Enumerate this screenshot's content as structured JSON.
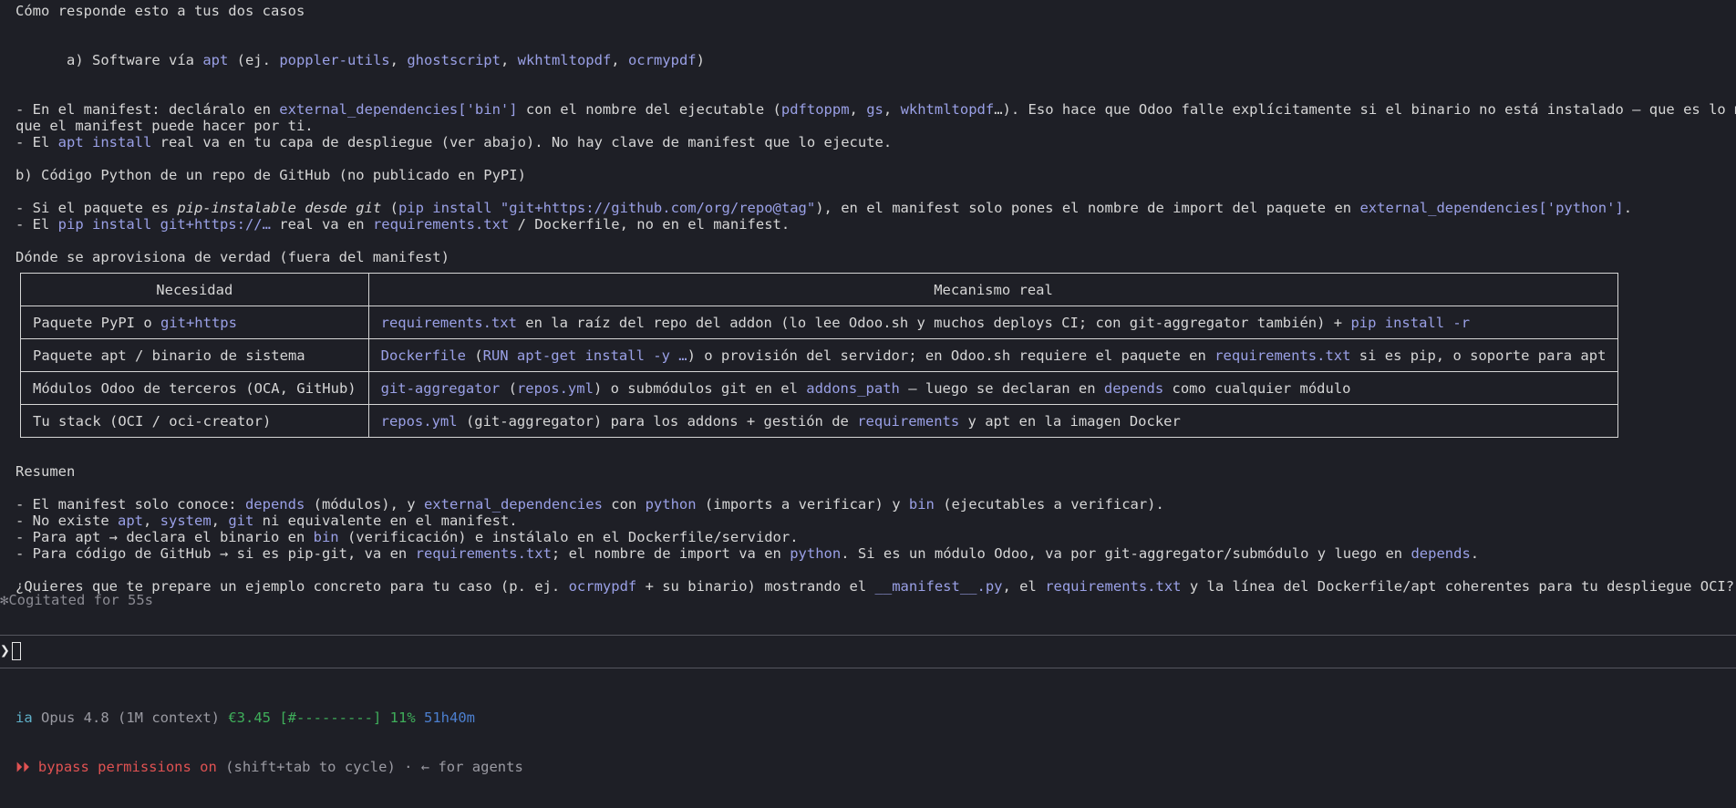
{
  "lines": {
    "h1": "Cómo responde esto a tus dos casos",
    "a": [
      "a) Software vía ",
      "apt",
      " (ej. ",
      "poppler-utils",
      ", ",
      "ghostscript",
      ", ",
      "wkhtmltopdf",
      ", ",
      "ocrmypdf",
      ")"
    ],
    "a1": [
      "- En el manifest: decláralo en ",
      "external_dependencies['bin']",
      " con el nombre del ejecutable (",
      "pdftoppm",
      ", ",
      "gs",
      ", ",
      "wkhtmltopdf",
      "…). Eso hace que Odoo falle explícitamente si el binario no está instalado — que es lo máximo"
    ],
    "a1b": "que el manifest puede hacer por ti.",
    "a2": [
      "- El ",
      "apt install",
      " real va en tu capa de despliegue (ver abajo). No hay clave de manifest que lo ejecute."
    ],
    "b": "b) Código Python de un repo de GitHub (no publicado en PyPI)",
    "b1": [
      "- Si el paquete es ",
      "pip-instalable desde git",
      " (",
      "pip install \"git+https://github.com/org/repo@tag\"",
      "), en el manifest solo pones el nombre de import del paquete en ",
      "external_dependencies['python']",
      "."
    ],
    "b2": [
      "- El ",
      "pip install git+https://…",
      " real va en ",
      "requirements.txt",
      " / Dockerfile, no en el manifest."
    ],
    "h2": "Dónde se aprovisiona de verdad (fuera del manifest)",
    "resumen": "Resumen",
    "r1": [
      "- El manifest solo conoce: ",
      "depends",
      " (módulos), y ",
      "external_dependencies",
      " con ",
      "python",
      " (imports a verificar) y ",
      "bin",
      " (ejecutables a verificar)."
    ],
    "r2": [
      "- No existe ",
      "apt",
      ", ",
      "system",
      ", ",
      "git",
      " ni equivalente en el manifest."
    ],
    "r3": [
      "- Para apt → declara el binario en ",
      "bin",
      " (verificación) e instálalo en el Dockerfile/servidor."
    ],
    "r4": [
      "- Para código de GitHub → si es pip-git, va en ",
      "requirements.txt",
      "; el nombre de import va en ",
      "python",
      ". Si es un módulo Odoo, va por git-aggregator/submódulo y luego en ",
      "depends",
      "."
    ],
    "q": [
      "¿Quieres que te prepare un ejemplo concreto para tu caso (p. ej. ",
      "ocrmypdf",
      " + su binario) mostrando el ",
      "__manifest__.py",
      ", el ",
      "requirements.txt",
      " y la línea del Dockerfile/apt coherentes para tu despliegue OCI?"
    ]
  },
  "table": {
    "headers": [
      "Necesidad",
      "Mecanismo real"
    ],
    "rows": [
      {
        "need": [
          "Paquete PyPI o ",
          "git+https"
        ],
        "mech": [
          "requirements.txt",
          " en la raíz del repo del addon (lo lee Odoo.sh y muchos deploys CI; con git-aggregator también) + ",
          "pip install -r"
        ]
      },
      {
        "need": [
          "Paquete apt / binario de sistema"
        ],
        "mech": [
          "Dockerfile",
          " (",
          "RUN apt-get install -y …",
          ") o provisión del servidor; en Odoo.sh requiere el paquete en ",
          "requirements.txt",
          " si es pip, o soporte para apt"
        ]
      },
      {
        "need": [
          "Módulos Odoo de terceros (OCA, GitHub)"
        ],
        "mech": [
          "git-aggregator",
          " (",
          "repos.yml",
          ") o submódulos git en el ",
          "addons_path",
          " — luego se declaran en ",
          "depends",
          " como cualquier módulo"
        ]
      },
      {
        "need": [
          "Tu stack (OCI / oci-creator)"
        ],
        "mech": [
          "repos.yml",
          " (git-aggregator) para los addons + gestión de ",
          "requirements",
          " y apt en la imagen Docker"
        ]
      }
    ]
  },
  "status": {
    "cogitated_star": "✻",
    "cogitated": "Cogitated for 55s",
    "prompt_symbol": "❯"
  },
  "footer": {
    "ia": "ia",
    "model": "Opus 4.8 (1M context)",
    "cost": "€3.45",
    "bar": "[#---------]",
    "pct": "11%",
    "time": "51h40m",
    "bypass_arrows": "⏵⏵",
    "bypass": "bypass permissions on",
    "hint": "(shift+tab to cycle) · ← for agents"
  },
  "colors": {
    "background": "#1e1f26",
    "text": "#d6d6d6",
    "code": "#9aa0e6",
    "model": "#5fb0c9",
    "cost": "#3fae5a",
    "time": "#4c7fcf",
    "bypass": "#e05252"
  }
}
